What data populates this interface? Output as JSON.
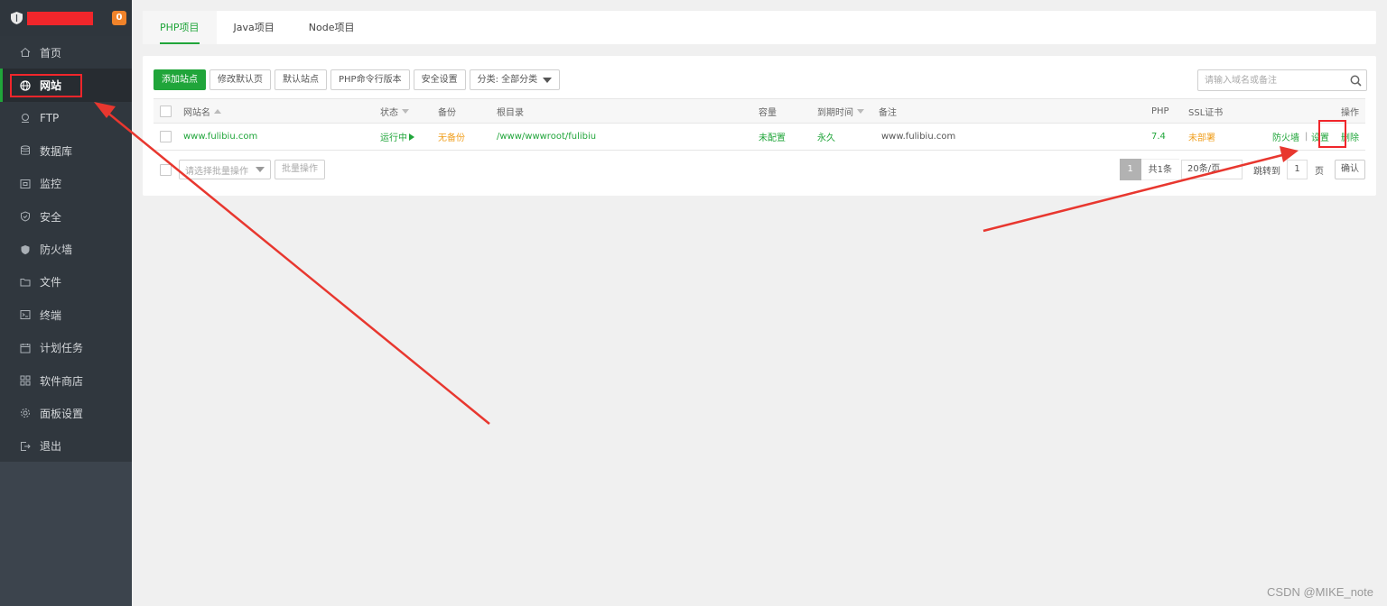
{
  "sidebar": {
    "badge_count": "0",
    "items": [
      {
        "label": "首页",
        "icon": "home-icon",
        "name": "sidebar-item-home"
      },
      {
        "label": "网站",
        "icon": "globe-icon",
        "name": "sidebar-item-website",
        "active": true
      },
      {
        "label": "FTP",
        "icon": "ftp-icon",
        "name": "sidebar-item-ftp"
      },
      {
        "label": "数据库",
        "icon": "database-icon",
        "name": "sidebar-item-database"
      },
      {
        "label": "监控",
        "icon": "monitor-icon",
        "name": "sidebar-item-monitor"
      },
      {
        "label": "安全",
        "icon": "shield-check-icon",
        "name": "sidebar-item-security"
      },
      {
        "label": "防火墙",
        "icon": "shield-icon",
        "name": "sidebar-item-firewall"
      },
      {
        "label": "文件",
        "icon": "folder-icon",
        "name": "sidebar-item-files"
      },
      {
        "label": "终端",
        "icon": "terminal-icon",
        "name": "sidebar-item-terminal"
      },
      {
        "label": "计划任务",
        "icon": "calendar-icon",
        "name": "sidebar-item-cron"
      },
      {
        "label": "软件商店",
        "icon": "grid-icon",
        "name": "sidebar-item-store"
      },
      {
        "label": "面板设置",
        "icon": "gear-icon",
        "name": "sidebar-item-settings"
      },
      {
        "label": "退出",
        "icon": "logout-icon",
        "name": "sidebar-item-logout"
      }
    ]
  },
  "tabs": [
    {
      "label": "PHP项目",
      "active": true
    },
    {
      "label": "Java项目"
    },
    {
      "label": "Node项目"
    }
  ],
  "toolbar": {
    "add_site": "添加站点",
    "edit_default_page": "修改默认页",
    "default_site": "默认站点",
    "php_cli_version": "PHP命令行版本",
    "security_settings": "安全设置",
    "category_select": "分类: 全部分类"
  },
  "search": {
    "placeholder": "请输入域名或备注"
  },
  "table": {
    "headers": {
      "site_name": "网站名",
      "status": "状态",
      "backup": "备份",
      "root_dir": "根目录",
      "quota": "容量",
      "expire": "到期时间",
      "remark": "备注",
      "php": "PHP",
      "ssl": "SSL证书",
      "actions": "操作"
    },
    "rows": [
      {
        "site_name": "www.fulibiu.com",
        "status": "运行中",
        "backup": "无备份",
        "root_dir": "/www/wwwroot/fulibiu",
        "quota": "未配置",
        "expire": "永久",
        "remark": "www.fulibiu.com",
        "php": "7.4",
        "ssl": "未部署",
        "action_firewall": "防火墙",
        "action_separator": "|",
        "action_settings": "设置",
        "action_delete": "删除"
      }
    ]
  },
  "footer": {
    "batch_placeholder": "请选择批量操作",
    "batch_button": "批量操作",
    "current_page": "1",
    "total": "共1条",
    "page_size": "20条/页",
    "jump_label": "跳转到",
    "jump_value": "1",
    "page_unit": "页",
    "confirm": "确认"
  },
  "watermark": "CSDN @MIKE_note",
  "colors": {
    "accent_green": "#20a53a",
    "highlight_red": "#f0262b",
    "warning_orange": "#f0a020",
    "sidebar_bg": "#3c444d"
  }
}
